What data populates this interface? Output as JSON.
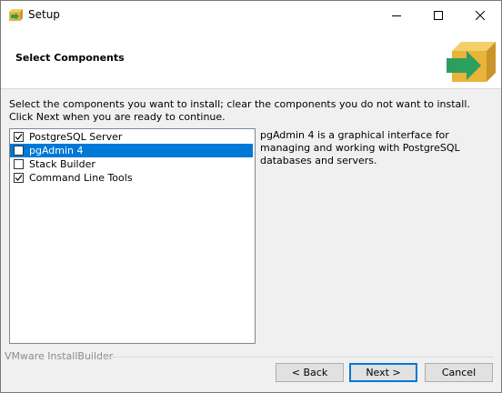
{
  "window": {
    "title": "Setup"
  },
  "header": {
    "title": "Select Components"
  },
  "instructions": "Select the components you want to install; clear the components you do not want to install. Click Next when you are ready to continue.",
  "components": [
    {
      "label": "PostgreSQL Server",
      "checked": true,
      "selected": false
    },
    {
      "label": "pgAdmin 4",
      "checked": false,
      "selected": true
    },
    {
      "label": "Stack Builder",
      "checked": false,
      "selected": false
    },
    {
      "label": "Command Line Tools",
      "checked": true,
      "selected": false
    }
  ],
  "description": "pgAdmin 4 is a graphical interface for managing and working with PostgreSQL databases and servers.",
  "footer": {
    "brand": "VMware InstallBuilder"
  },
  "buttons": {
    "back": "< Back",
    "next": "Next >",
    "cancel": "Cancel"
  },
  "colors": {
    "selection": "#0078d7",
    "icon_box": "#e8b43a",
    "icon_arrow": "#2e9e5e"
  },
  "icons": {
    "app": "installer-box-icon",
    "header": "installer-box-arrow-icon"
  }
}
